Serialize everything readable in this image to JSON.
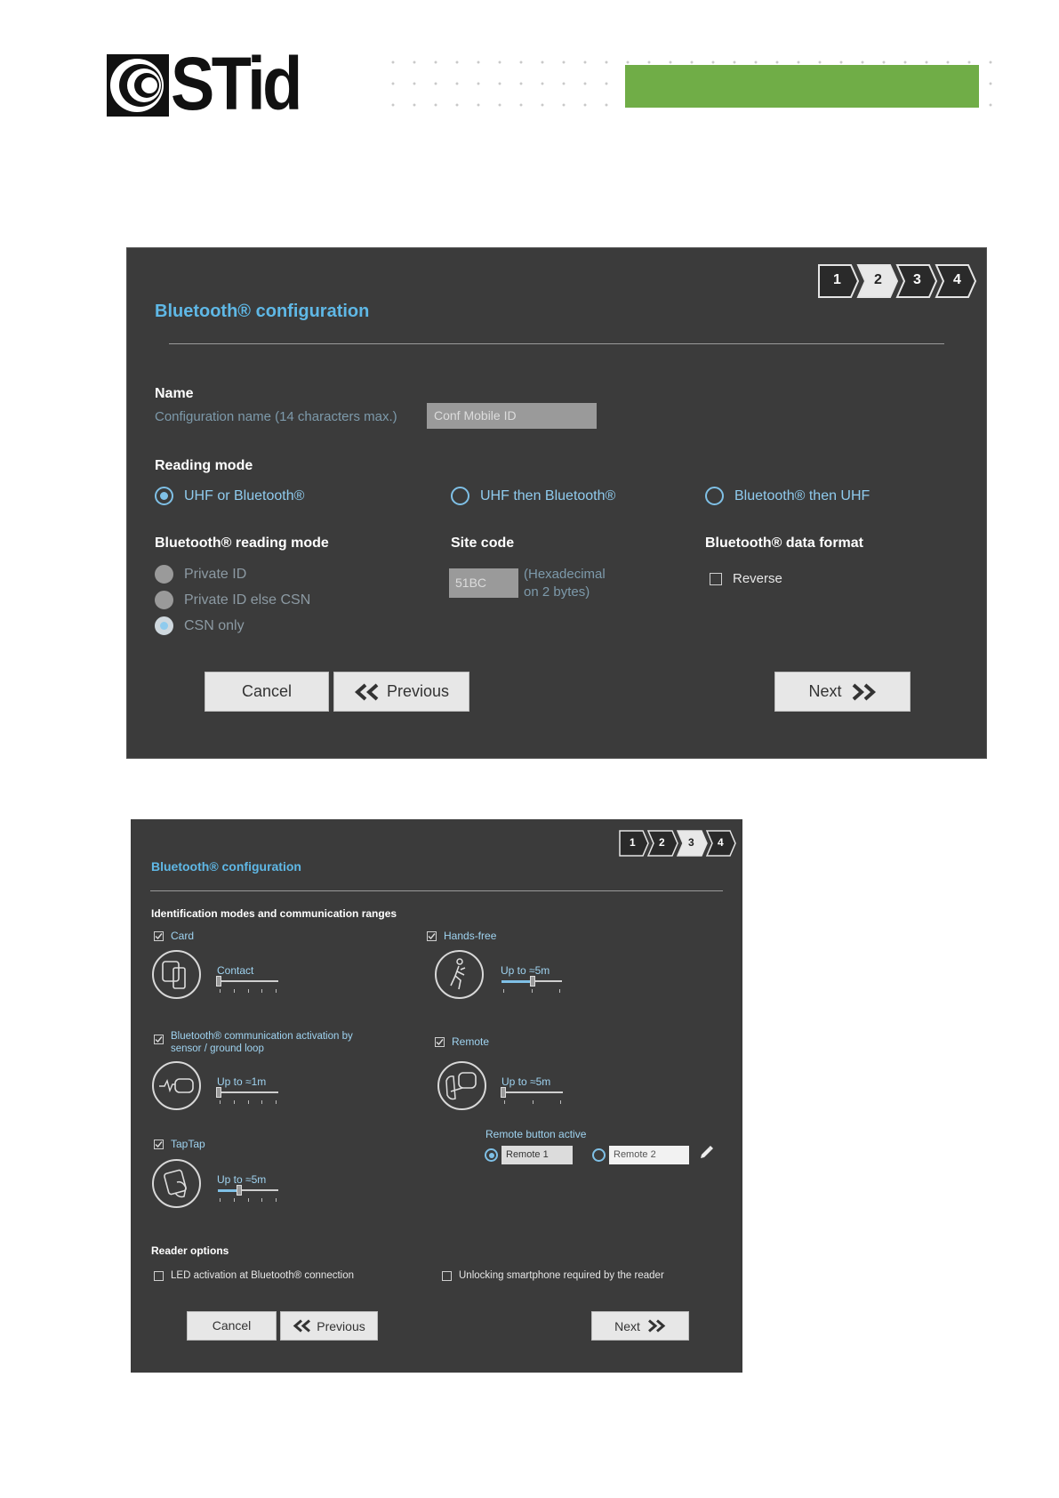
{
  "header": {
    "logo_text": "STid",
    "accent_color": "#70ad47"
  },
  "screen1": {
    "steps": [
      "1",
      "2",
      "3",
      "4"
    ],
    "active_step": 2,
    "title": "Bluetooth® configuration",
    "name": {
      "label": "Name",
      "hint": "Configuration name (14 characters max.)",
      "value": "Conf Mobile ID"
    },
    "reading_mode": {
      "label": "Reading mode",
      "options": [
        "UHF or Bluetooth®",
        "UHF then Bluetooth®",
        "Bluetooth® then UHF"
      ],
      "selected": "UHF or Bluetooth®"
    },
    "bt_reading_mode": {
      "label": "Bluetooth® reading mode",
      "options": [
        "Private ID",
        "Private ID else CSN",
        "CSN only"
      ],
      "selected": "CSN only"
    },
    "site_code": {
      "label": "Site code",
      "value": "51BC",
      "hint_line1": "(Hexadecimal",
      "hint_line2": "on 2 bytes)"
    },
    "data_format": {
      "label": "Bluetooth® data format",
      "reverse_label": "Reverse",
      "reverse_checked": false
    },
    "buttons": {
      "cancel": "Cancel",
      "previous": "Previous",
      "next": "Next"
    }
  },
  "screen2": {
    "steps": [
      "1",
      "2",
      "3",
      "4"
    ],
    "active_step": 3,
    "title": "Bluetooth® configuration",
    "section_title": "Identification modes and communication ranges",
    "modes": {
      "card": {
        "label": "Card",
        "checked": true,
        "range": "Contact",
        "level": 0
      },
      "handsfree": {
        "label": "Hands-free",
        "checked": true,
        "range": "Up to ≈5m",
        "level": 0.5
      },
      "sensor": {
        "label_line1": "Bluetooth® communication activation by",
        "label_line2": "sensor / ground loop",
        "checked": true,
        "range": "Up to ≈1m",
        "level": 0
      },
      "remote": {
        "label": "Remote",
        "checked": true,
        "range": "Up to ≈5m",
        "level": 0
      },
      "taptap": {
        "label": "TapTap",
        "checked": true,
        "range": "Up to ≈5m",
        "level": 0.33
      }
    },
    "remote_button": {
      "label": "Remote button active",
      "option1": "Remote 1",
      "option2": "Remote 2",
      "selected": "Remote 1"
    },
    "reader_options": {
      "label": "Reader options",
      "led": "LED activation at Bluetooth® connection",
      "unlock": "Unlocking smartphone required by the reader"
    },
    "buttons": {
      "cancel": "Cancel",
      "previous": "Previous",
      "next": "Next"
    }
  }
}
